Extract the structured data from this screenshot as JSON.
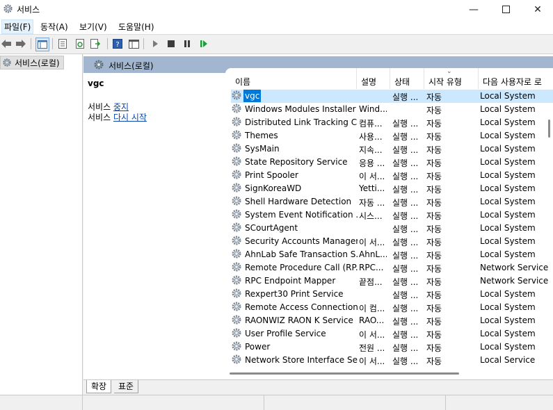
{
  "window": {
    "title": "서비스"
  },
  "menu": [
    "파일(F)",
    "동작(A)",
    "보기(V)",
    "도움말(H)"
  ],
  "toolbar_icons": [
    "back-arrow-icon",
    "forward-arrow-icon",
    "show-hide-console-tree-icon",
    "properties-icon",
    "refresh-icon",
    "export-list-icon",
    "help-icon",
    "details-view-icon",
    "start-icon",
    "stop-icon",
    "pause-icon",
    "resume-icon"
  ],
  "tree": {
    "root_label": "서비스(로컬)"
  },
  "pane": {
    "header": "서비스(로컬)"
  },
  "desc": {
    "name": "vgc",
    "stop_prefix": "서비스",
    "stop_link": "중지",
    "restart_prefix": "서비스",
    "restart_link": "다시 시작"
  },
  "columns": [
    "이름",
    "설명",
    "상태",
    "시작 유형",
    "다음 사용자로 로"
  ],
  "rows": [
    {
      "name": "vgc",
      "desc": "",
      "status": "실행 ...",
      "startup": "자동",
      "logon": "Local System",
      "selected": true
    },
    {
      "name": "Windows Modules Installer",
      "desc": "Wind...",
      "status": "",
      "startup": "자동",
      "logon": "Local System"
    },
    {
      "name": "Distributed Link Tracking C...",
      "desc": "컴퓨...",
      "status": "실행 ...",
      "startup": "자동",
      "logon": "Local System"
    },
    {
      "name": "Themes",
      "desc": "사용...",
      "status": "실행 ...",
      "startup": "자동",
      "logon": "Local System"
    },
    {
      "name": "SysMain",
      "desc": "지속...",
      "status": "실행 ...",
      "startup": "자동",
      "logon": "Local System"
    },
    {
      "name": "State Repository Service",
      "desc": "응용 ...",
      "status": "실행 ...",
      "startup": "자동",
      "logon": "Local System"
    },
    {
      "name": "Print Spooler",
      "desc": "이 서...",
      "status": "실행 ...",
      "startup": "자동",
      "logon": "Local System"
    },
    {
      "name": "SignKoreaWD",
      "desc": "Yetti...",
      "status": "실행 ...",
      "startup": "자동",
      "logon": "Local System"
    },
    {
      "name": "Shell Hardware Detection",
      "desc": "자동 ...",
      "status": "실행 ...",
      "startup": "자동",
      "logon": "Local System"
    },
    {
      "name": "System Event Notification ...",
      "desc": "시스...",
      "status": "실행 ...",
      "startup": "자동",
      "logon": "Local System"
    },
    {
      "name": "SCourtAgent",
      "desc": "",
      "status": "실행 ...",
      "startup": "자동",
      "logon": "Local System"
    },
    {
      "name": "Security Accounts Manager",
      "desc": "이 서...",
      "status": "실행 ...",
      "startup": "자동",
      "logon": "Local System"
    },
    {
      "name": "AhnLab Safe Transaction S...",
      "desc": "AhnL...",
      "status": "실행 ...",
      "startup": "자동",
      "logon": "Local System"
    },
    {
      "name": "Remote Procedure Call (RP...",
      "desc": "RPC...",
      "status": "실행 ...",
      "startup": "자동",
      "logon": "Network Service"
    },
    {
      "name": "RPC Endpoint Mapper",
      "desc": "끝점...",
      "status": "실행 ...",
      "startup": "자동",
      "logon": "Network Service"
    },
    {
      "name": "Rexpert30 Print Service",
      "desc": "",
      "status": "실행 ...",
      "startup": "자동",
      "logon": "Local System"
    },
    {
      "name": "Remote Access Connection...",
      "desc": "이 컴...",
      "status": "실행 ...",
      "startup": "자동",
      "logon": "Local System"
    },
    {
      "name": "RAONWIZ RAON K Service",
      "desc": "RAO...",
      "status": "실행 ...",
      "startup": "자동",
      "logon": "Local System"
    },
    {
      "name": "User Profile Service",
      "desc": "이 서...",
      "status": "실행 ...",
      "startup": "자동",
      "logon": "Local System"
    },
    {
      "name": "Power",
      "desc": "전원 ...",
      "status": "실행 ...",
      "startup": "자동",
      "logon": "Local System"
    },
    {
      "name": "Network Store Interface Se...",
      "desc": "이 서...",
      "status": "실행 ...",
      "startup": "자동",
      "logon": "Local Service"
    }
  ],
  "tabs": [
    "확장",
    "표준"
  ],
  "colors": {
    "header_bar": "#a2b7cf",
    "selection": "#0078d7",
    "link": "#0645ad"
  }
}
